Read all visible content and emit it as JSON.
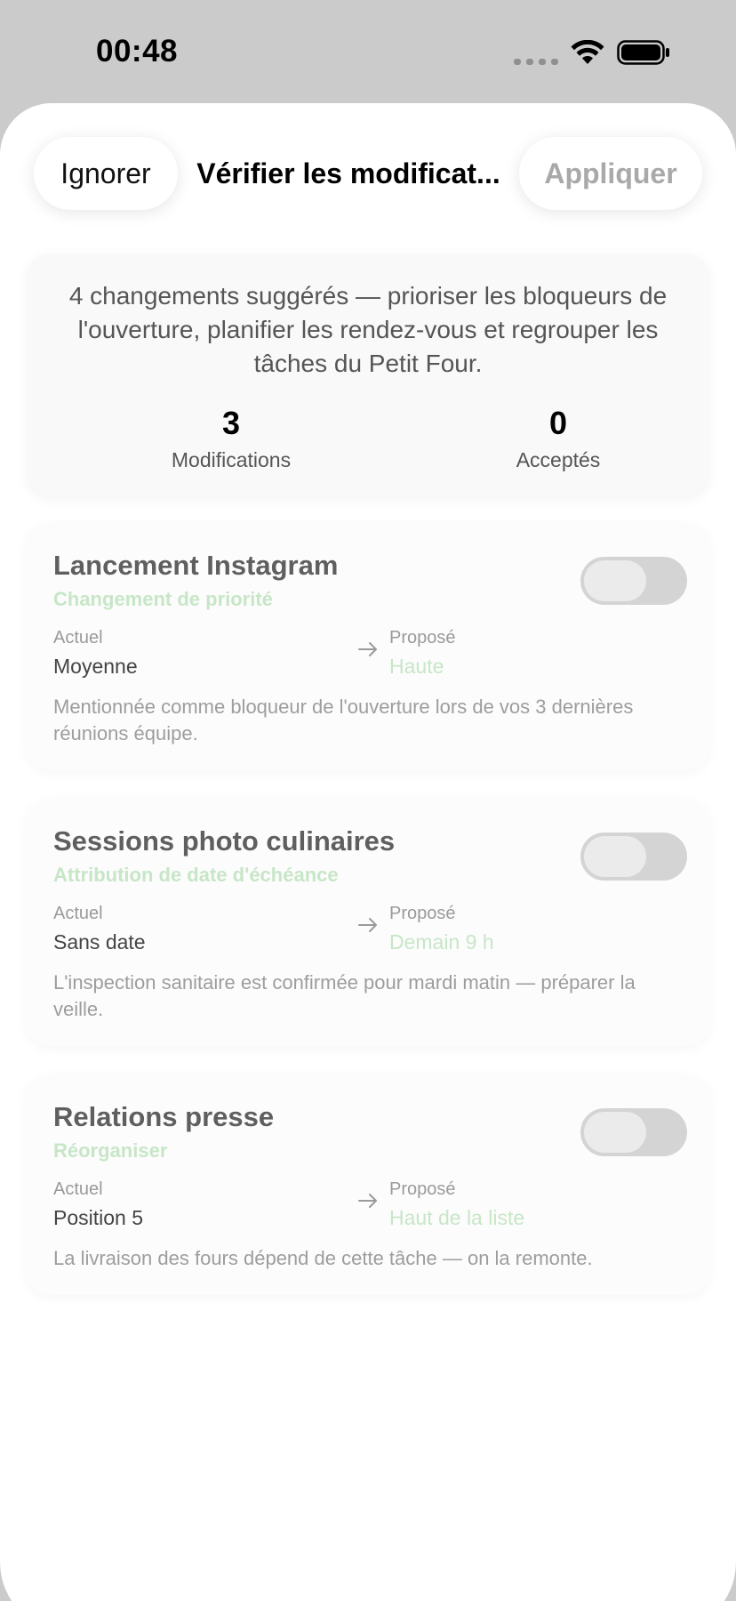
{
  "status_bar": {
    "time": "00:48"
  },
  "header": {
    "ignore_label": "Ignorer",
    "title": "Vérifier les modificat...",
    "apply_label": "Appliquer"
  },
  "summary": {
    "text": "4 changements suggérés — prioriser les bloqueurs de l'ouverture, planifier les rendez-vous et regrouper les tâches du Petit Four.",
    "modifications_value": "3",
    "modifications_label": "Modifications",
    "accepted_value": "0",
    "accepted_label": "Acceptés"
  },
  "changes": [
    {
      "title": "Lancement Instagram",
      "type": "Changement de priorité",
      "current_label": "Actuel",
      "current_value": "Moyenne",
      "proposed_label": "Proposé",
      "proposed_value": "Haute",
      "reason": "Mentionnée comme bloqueur de l'ouverture lors de vos 3 dernières réunions équipe.",
      "accepted": false
    },
    {
      "title": "Sessions photo culinaires",
      "type": "Attribution de date d'échéance",
      "current_label": "Actuel",
      "current_value": "Sans date",
      "proposed_label": "Proposé",
      "proposed_value": "Demain 9 h",
      "reason": "L'inspection sanitaire est confirmée pour mardi matin — préparer la veille.",
      "accepted": false
    },
    {
      "title": "Relations presse",
      "type": "Réorganiser",
      "current_label": "Actuel",
      "current_value": "Position 5",
      "proposed_label": "Proposé",
      "proposed_value": "Haut de la liste",
      "reason": "La livraison des fours dépend de cette tâche — on la remonte.",
      "accepted": false
    }
  ],
  "colors": {
    "accent_green": "#c7e6c7",
    "toggle_off": "#d4d4d4",
    "apply_disabled": "#a9a9a9"
  }
}
